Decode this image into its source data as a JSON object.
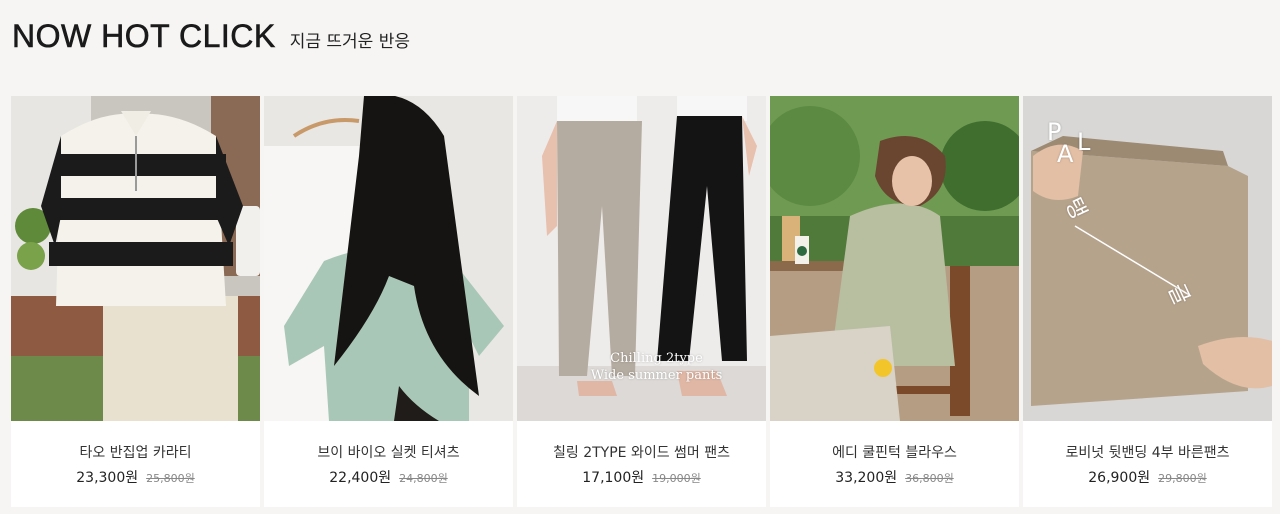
{
  "section": {
    "title": "NOW HOT CLICK",
    "subtitle": "지금 뜨거운 반응"
  },
  "products": [
    {
      "name": "타오 반집업 카라티",
      "price": "23,300원",
      "original_price": "25,800원"
    },
    {
      "name": "브이 바이오 실켓 티셔츠",
      "price": "22,400원",
      "original_price": "24,800원"
    },
    {
      "name": "칠링 2TYPE 와이드 썸머 팬츠",
      "price": "17,100원",
      "original_price": "19,000원",
      "image_text": [
        "Chilling 2type",
        "Wide summer pants"
      ]
    },
    {
      "name": "에디 쿨핀턱 블라우스",
      "price": "33,200원",
      "original_price": "36,800원"
    },
    {
      "name": "로비넛 뒷밴딩 4부 바른팬츠",
      "price": "26,900원",
      "original_price": "29,800원",
      "image_text": [
        "P",
        "A",
        "L",
        "탱",
        "글"
      ]
    }
  ],
  "colors": {
    "background": "#f6f5f4",
    "card": "#ffffff",
    "price_text": "#222222",
    "original_price_text": "#888888"
  }
}
